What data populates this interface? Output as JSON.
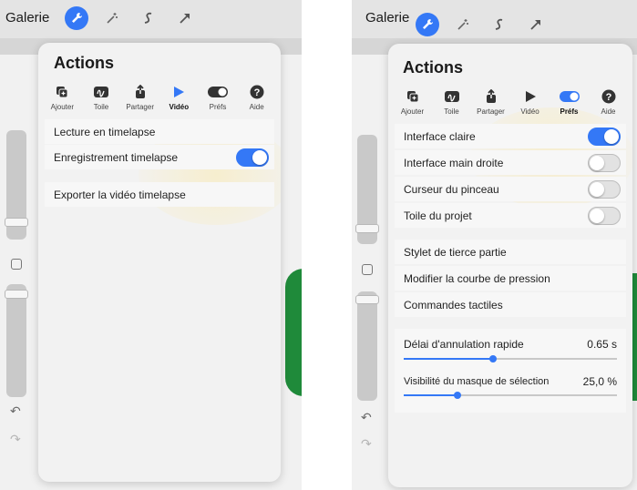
{
  "left": {
    "galerie": "Galerie",
    "title": "Actions",
    "tabs": [
      {
        "label": "Ajouter",
        "icon": "add-icon"
      },
      {
        "label": "Toile",
        "icon": "canvas-icon"
      },
      {
        "label": "Partager",
        "icon": "share-icon"
      },
      {
        "label": "Vidéo",
        "icon": "play-icon"
      },
      {
        "label": "Préfs",
        "icon": "toggle-icon"
      },
      {
        "label": "Aide",
        "icon": "help-icon"
      }
    ],
    "active_tab": "Vidéo",
    "items": {
      "lecture": "Lecture en timelapse",
      "enregistrement": "Enregistrement timelapse",
      "exporter": "Exporter la vidéo timelapse"
    },
    "enregistrement_on": true
  },
  "right": {
    "galerie": "Galerie",
    "title": "Actions",
    "tabs": [
      {
        "label": "Ajouter",
        "icon": "add-icon"
      },
      {
        "label": "Toile",
        "icon": "canvas-icon"
      },
      {
        "label": "Partager",
        "icon": "share-icon"
      },
      {
        "label": "Vidéo",
        "icon": "play-icon"
      },
      {
        "label": "Préfs",
        "icon": "toggle-icon"
      },
      {
        "label": "Aide",
        "icon": "help-icon"
      }
    ],
    "active_tab": "Préfs",
    "toggles": [
      {
        "label": "Interface claire",
        "on": true
      },
      {
        "label": "Interface main droite",
        "on": false
      },
      {
        "label": "Curseur du pinceau",
        "on": false
      },
      {
        "label": "Toile du projet",
        "on": false
      }
    ],
    "links": {
      "stylet": "Stylet de tierce partie",
      "courbe": "Modifier la courbe de pression",
      "commandes": "Commandes tactiles"
    },
    "delai": {
      "label": "Délai d'annulation rapide",
      "value": "0.65 s",
      "fraction": 0.42
    },
    "masque": {
      "label": "Visibilité du masque de sélection",
      "value": "25,0 %",
      "fraction": 0.25
    }
  },
  "colors": {
    "accent": "#3478f6",
    "green_shape": "#1f8a3a"
  }
}
